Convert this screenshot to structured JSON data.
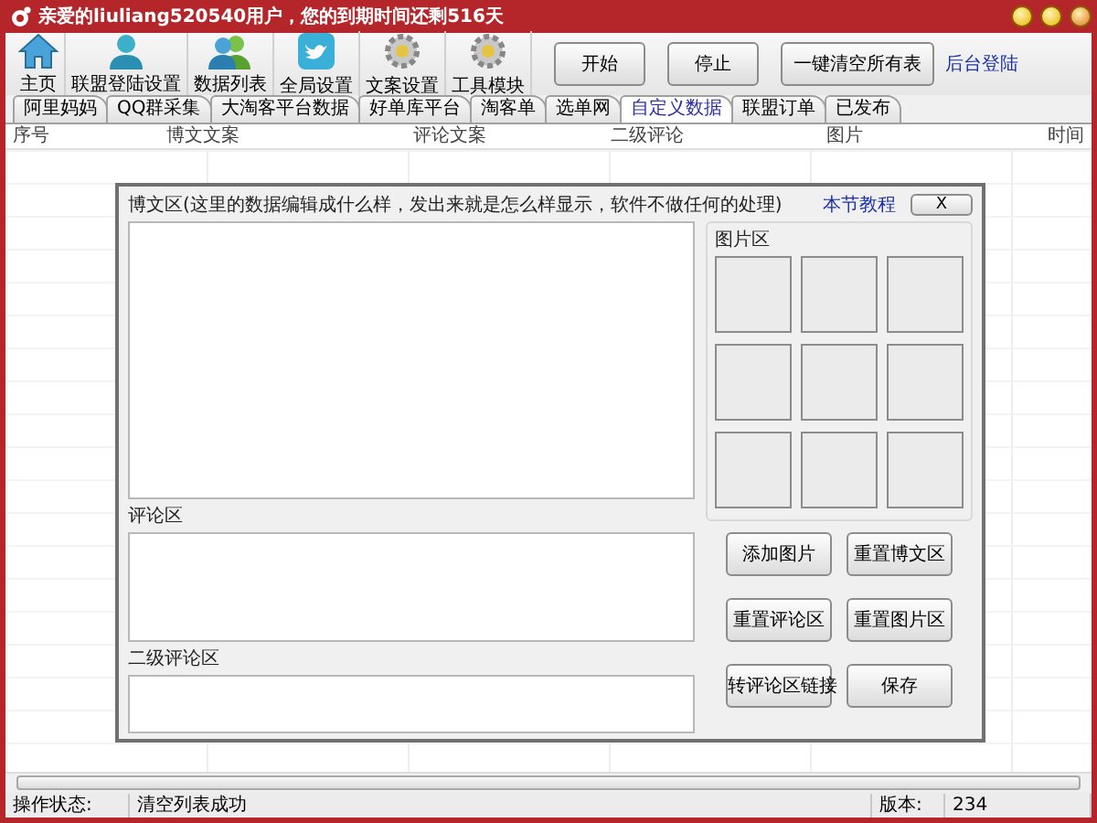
{
  "window": {
    "title": "亲爱的liuliang520540用户，您的到期时间还剩516天"
  },
  "toolbar": {
    "items": [
      "主页",
      "联盟登陆设置",
      "数据列表",
      "全局设置",
      "文案设置",
      "工具模块"
    ],
    "buttons": [
      "开始",
      "停止",
      "一键清空所有表"
    ],
    "link": "后台登陆"
  },
  "tabs": [
    {
      "label": "阿里妈妈",
      "selected": false
    },
    {
      "label": "QQ群采集",
      "selected": false
    },
    {
      "label": "大淘客平台数据",
      "selected": false
    },
    {
      "label": "好单库平台",
      "selected": false
    },
    {
      "label": "淘客单",
      "selected": false
    },
    {
      "label": "选单网",
      "selected": false
    },
    {
      "label": "自定义数据",
      "selected": true
    },
    {
      "label": "联盟订单",
      "selected": false
    },
    {
      "label": "已发布",
      "selected": false
    }
  ],
  "table": {
    "columns": [
      "序号",
      "博文文案",
      "评论文案",
      "二级评论",
      "图片",
      "时间"
    ]
  },
  "dialog": {
    "post_label": "博文区(这里的数据编辑成什么样，发出来就是怎么样显示，软件不做任何的处理)",
    "tutorial_link": "本节教程",
    "close": "X",
    "comment_label": "评论区",
    "sub_comment_label": "二级评论区",
    "picture_label": "图片区",
    "buttons": [
      "添加图片",
      "重置博文区",
      "重置评论区",
      "重置图片区",
      "转评论区链接",
      "保存"
    ]
  },
  "status_bar": {
    "label": "操作状态:",
    "message": "清空列表成功",
    "version_label": "版本:",
    "version": "234"
  }
}
